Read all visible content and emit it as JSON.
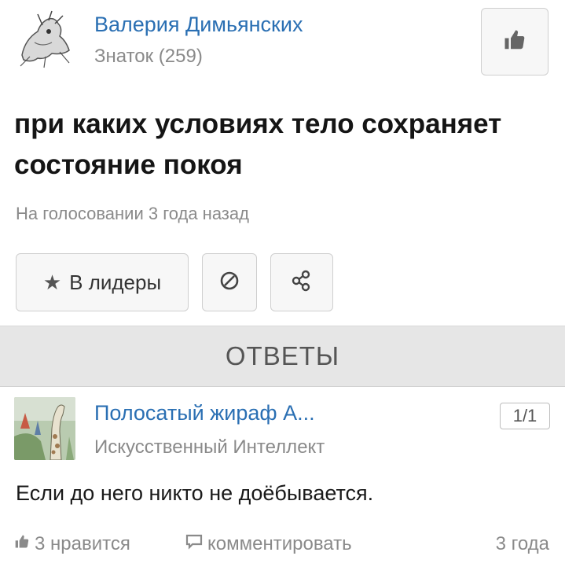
{
  "question": {
    "author": {
      "name": "Валерия Димьянских",
      "rank": "Знаток (259)"
    },
    "title": "при каких условиях тело сохраняет состояние покоя",
    "meta": "На голосовании 3 года назад",
    "actions": {
      "leaders_label": "В лидеры",
      "leaders_icon": "star-icon",
      "block_icon": "block-icon",
      "share_icon": "share-icon"
    },
    "like_icon": "thumbs-up-icon"
  },
  "answers_header": "ОТВЕТЫ",
  "answer": {
    "author": {
      "name": "Полосатый жираф А...",
      "rank": "Искусственный Интеллект"
    },
    "counter": "1/1",
    "text": "Если до него никто не доёбывается.",
    "likes": "3 нравится",
    "comment_label": "комментировать",
    "time": "3 года"
  },
  "colors": {
    "link": "#2a6fb3",
    "muted": "#8a8a8a",
    "bar": "#e6e6e6"
  }
}
